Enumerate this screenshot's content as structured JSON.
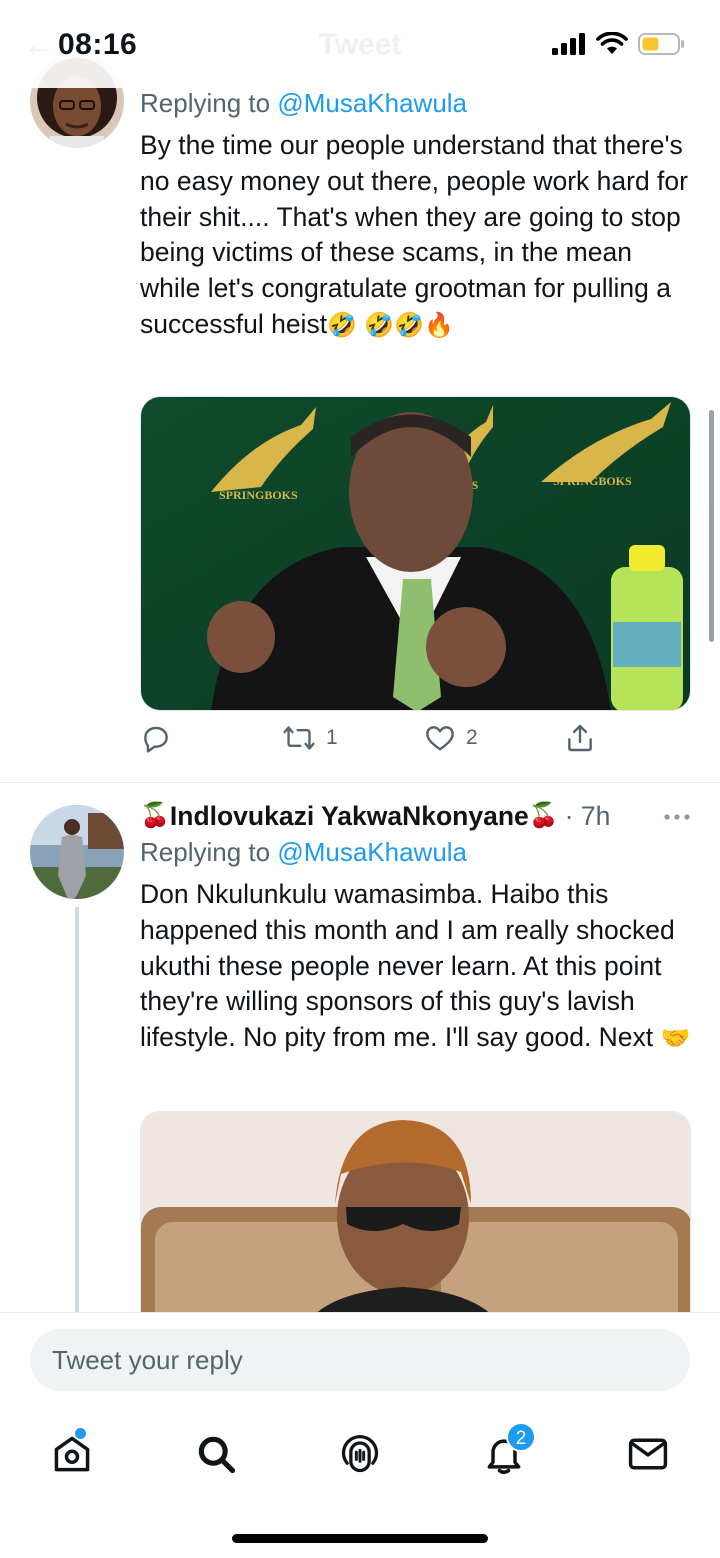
{
  "status_bar": {
    "time": "08:16",
    "ghost_title": "Tweet",
    "ghost_back": "←",
    "icons": [
      "signal-icon",
      "wifi-icon",
      "battery-low-icon"
    ]
  },
  "tweet1": {
    "replying_prefix": "Replying to",
    "replying_handle": "@MusaKhawula",
    "text": "By the time our people understand that there's no easy money out there, people work hard for their shit.... That's when they are going to stop being victims of these scams, in the mean while let's congratulate grootman for pulling a successful heist",
    "text_emojis": "🤣",
    "trailing_emojis": "🤣🤣🔥",
    "image_banner_text": "SPRINGBOKS",
    "image_banner_partial": "OKS",
    "actions": {
      "retweets": "1",
      "likes": "2"
    }
  },
  "tweet2": {
    "name_prefix_emoji": "🍒",
    "author_name": "Indlovukazi YakwaNkonyane",
    "name_suffix_emoji": "🍒",
    "time": "· 7h",
    "more": "···",
    "replying_prefix": "Replying to",
    "replying_handle": "@MusaKhawula",
    "text": "Don Nkulunkulu wamasimba. Haibo this happened this month and I am really shocked ukuthi these people never learn. At this point they're willing sponsors of this guy's lavish lifestyle. No pity from me. I'll say good. Next",
    "text_emoji": "🤝"
  },
  "composer": {
    "placeholder": "Tweet your reply"
  },
  "nav": {
    "notifications_badge": "2",
    "items": [
      "home-icon",
      "search-icon",
      "spaces-icon",
      "notifications-icon",
      "messages-icon"
    ]
  },
  "colors": {
    "accent": "#1d9bf0",
    "muted": "#536471",
    "separator": "#e6ecf0"
  }
}
